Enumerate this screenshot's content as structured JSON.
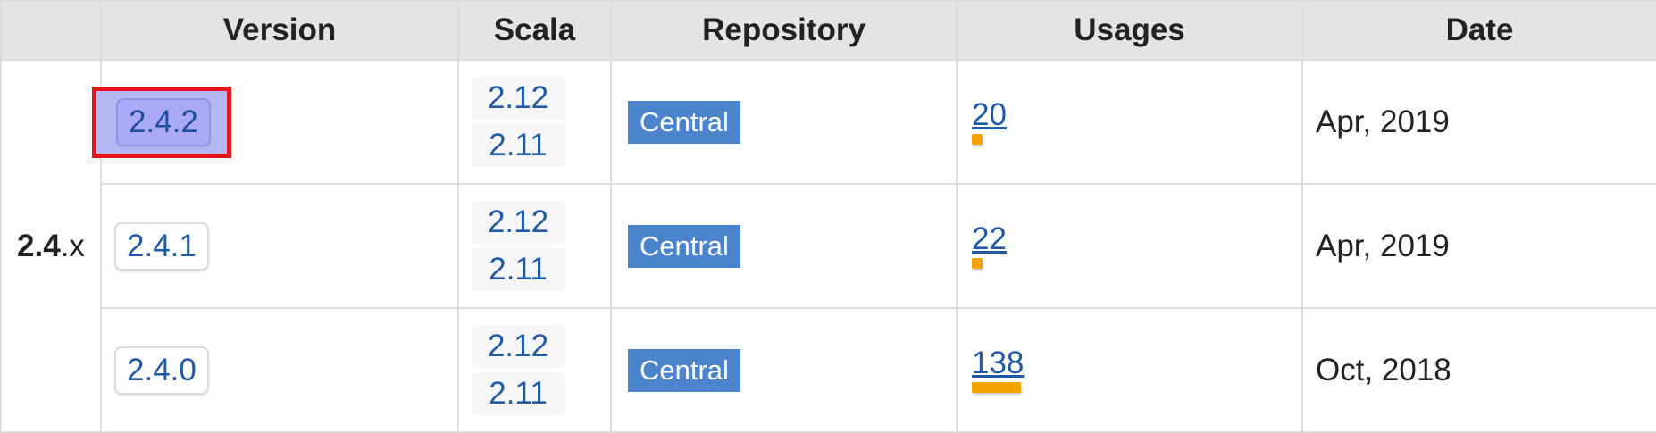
{
  "headers": {
    "version": "Version",
    "scala": "Scala",
    "repository": "Repository",
    "usages": "Usages",
    "date": "Date"
  },
  "group": {
    "bold": "2.4",
    "suffix": ".x"
  },
  "rows": [
    {
      "version": "2.4.2",
      "selected": true,
      "scala": [
        "2.12",
        "2.11"
      ],
      "repository": "Central",
      "usages": "20",
      "usage_ratio": 0.145,
      "date": "Apr, 2019"
    },
    {
      "version": "2.4.1",
      "selected": false,
      "scala": [
        "2.12",
        "2.11"
      ],
      "repository": "Central",
      "usages": "22",
      "usage_ratio": 0.16,
      "date": "Apr, 2019"
    },
    {
      "version": "2.4.0",
      "selected": false,
      "scala": [
        "2.12",
        "2.11"
      ],
      "repository": "Central",
      "usages": "138",
      "usage_ratio": 1.0,
      "date": "Oct, 2018"
    }
  ],
  "colors": {
    "header_bg": "#e4e4e4",
    "link": "#1f5aa6",
    "repo_badge": "#4b83cc",
    "usage_bar": "#f5a300",
    "selection_outline": "#e8141a",
    "selection_fill": "#b7b7f6"
  }
}
